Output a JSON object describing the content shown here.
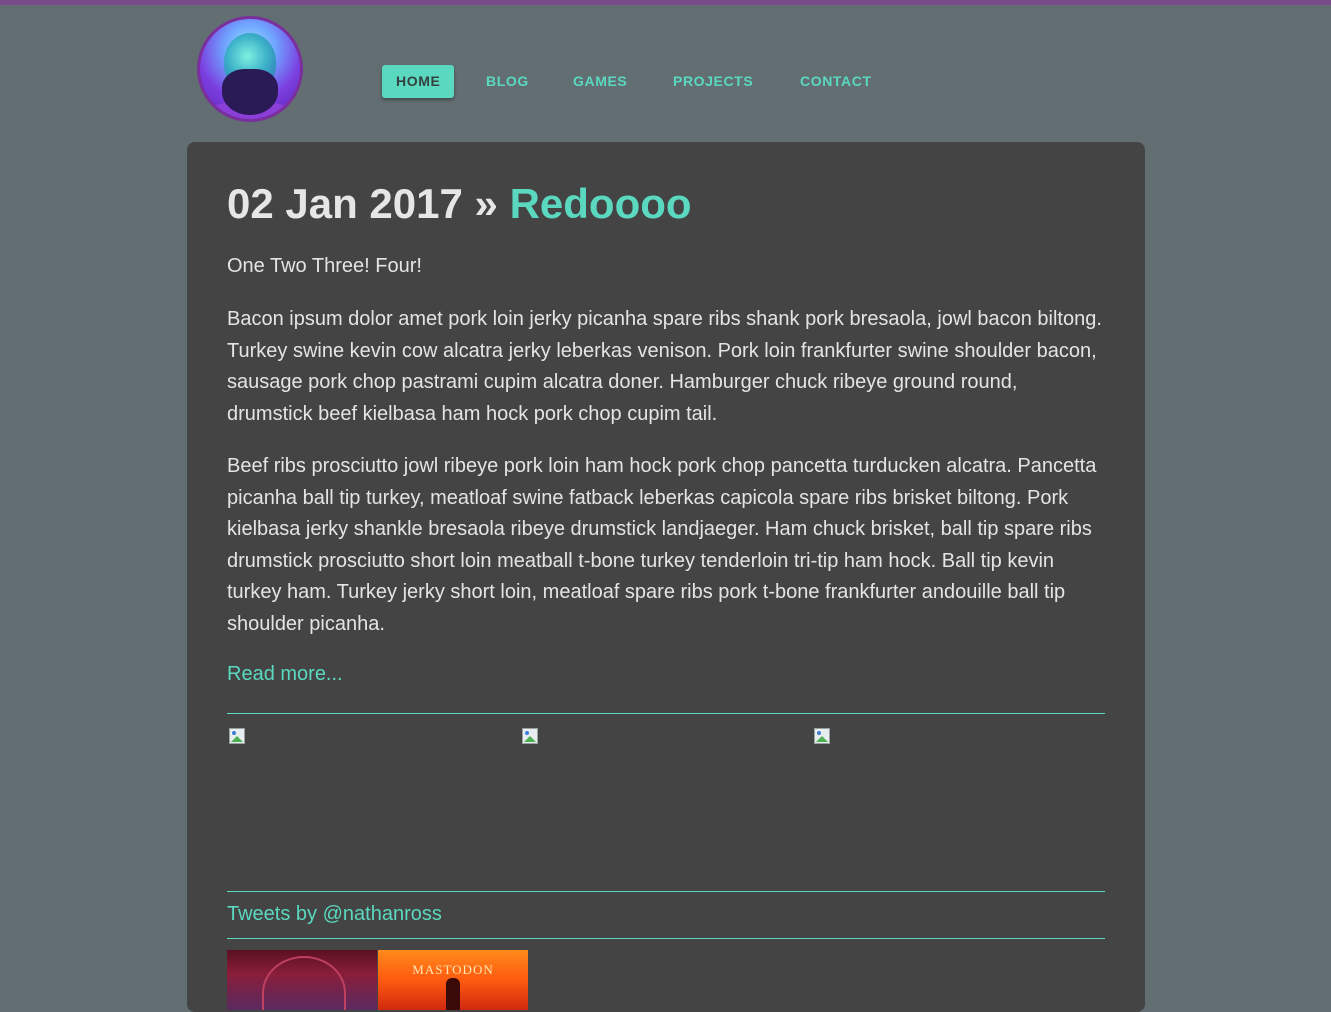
{
  "header": {
    "avatar_alt": "Nathan Ross avatar",
    "nav": [
      {
        "label": "HOME",
        "active": true
      },
      {
        "label": "BLOG",
        "active": false
      },
      {
        "label": "GAMES",
        "active": false
      },
      {
        "label": "PROJECTS",
        "active": false
      },
      {
        "label": "CONTACT",
        "active": false
      }
    ]
  },
  "post": {
    "date": "02 Jan 2017",
    "separator": "»",
    "title": "Redoooo",
    "paragraphs": [
      "One Two Three! Four!",
      "Bacon ipsum dolor amet pork loin jerky picanha spare ribs shank pork bresaola, jowl bacon biltong. Turkey swine kevin cow alcatra jerky leberkas venison. Pork loin frankfurter swine shoulder bacon, sausage pork chop pastrami cupim alcatra doner. Hamburger chuck ribeye ground round, drumstick beef kielbasa ham hock pork chop cupim tail.",
      "Beef ribs prosciutto jowl ribeye pork loin ham hock pork chop pancetta turducken alcatra. Pancetta picanha ball tip turkey, meatloaf swine fatback leberkas capicola spare ribs brisket biltong. Pork kielbasa jerky shankle bresaola ribeye drumstick landjaeger. Ham chuck brisket, ball tip spare ribs drumstick prosciutto short loin meatball t-bone turkey tenderloin tri-tip ham hock. Ball tip kevin turkey ham. Turkey jerky short loin, meatloaf spare ribs pork t-bone frankfurter andouille ball tip shoulder picanha."
    ],
    "read_more": "Read more..."
  },
  "tweets": {
    "link": "Tweets by @nathanross"
  },
  "thumbnails": {
    "second_label": "MASTODON"
  },
  "colors": {
    "accent": "#5ad8c0",
    "page_bg": "#626e72",
    "card_bg": "#444444",
    "topbar": "#7b4a8c"
  }
}
